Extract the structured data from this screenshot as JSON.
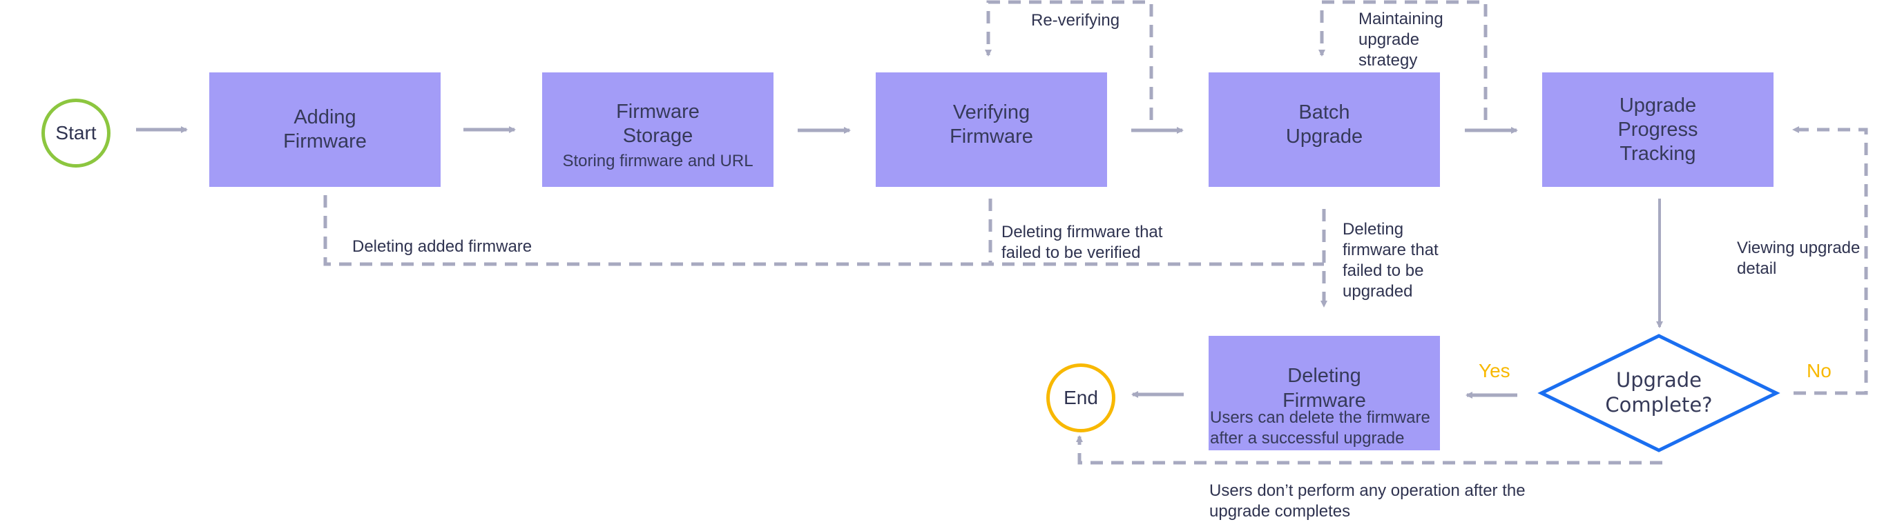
{
  "title": "Firmware upgrade flow",
  "colors": {
    "process_fill": "#a39cf7",
    "connector": "#a7a9c0",
    "start_border": "#8cc63f",
    "end_border": "#f8b800",
    "decision_border": "#1a6ef0",
    "branch_label": "#f8b800"
  },
  "start": {
    "label": "Start"
  },
  "end": {
    "label": "End"
  },
  "steps": [
    {
      "id": "adding",
      "title": "Adding\nFirmware",
      "subtitle": ""
    },
    {
      "id": "storage",
      "title": "Firmware\nStorage",
      "subtitle": "Storing firmware and URL"
    },
    {
      "id": "verifying",
      "title": "Verifying\nFirmware",
      "subtitle": ""
    },
    {
      "id": "batch",
      "title": "Batch\nUpgrade",
      "subtitle": ""
    },
    {
      "id": "tracking",
      "title": "Upgrade\nProgress\nTracking",
      "subtitle": ""
    },
    {
      "id": "deleting",
      "title": "Deleting\nFirmware",
      "subtitle": "Users can delete the firmware\nafter a successful upgrade"
    }
  ],
  "decision": {
    "label": "Upgrade\nComplete?",
    "yes_label": "Yes",
    "no_label": "No"
  },
  "annotations": {
    "reverifying": "Re-verifying",
    "maintaining": "Maintaining\nupgrade\nstrategy",
    "delete_added": "Deleting added firmware",
    "delete_failed_verify": "Deleting firmware that\nfailed to be verified",
    "delete_failed_upgrade": "Deleting\nfirmware that\nfailed to be\nupgraded",
    "viewing_detail": "Viewing upgrade\ndetail",
    "no_operation": "Users don’t perform any operation after the\nupgrade completes"
  }
}
